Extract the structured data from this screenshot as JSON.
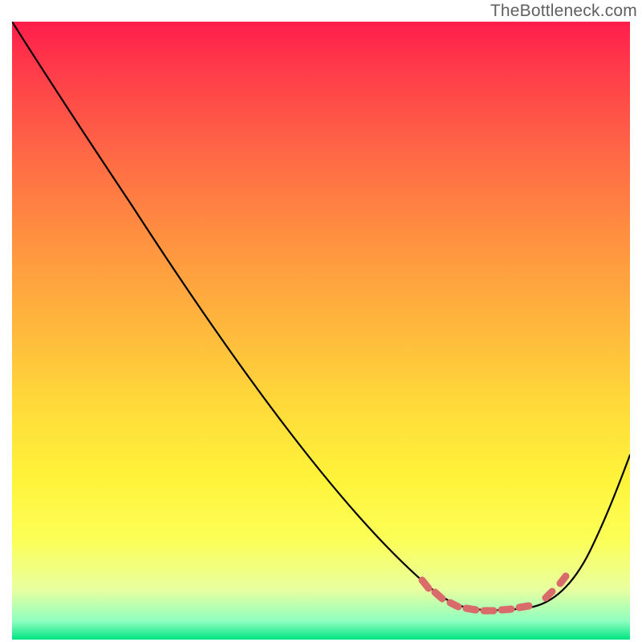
{
  "watermark": "TheBottleneck.com",
  "colors": {
    "gradient_top": "#ff1e4a",
    "gradient_mid": "#ffda3a",
    "gradient_bottom": "#00e582",
    "curve": "#000000",
    "ticks": "#d96b6b",
    "watermark_text": "#606060"
  },
  "chart_data": {
    "type": "line",
    "title": "",
    "xlabel": "",
    "ylabel": "",
    "xlim": [
      0,
      100
    ],
    "ylim": [
      0,
      100
    ],
    "series": [
      {
        "name": "curve",
        "x": [
          0,
          10,
          20,
          30,
          40,
          50,
          60,
          67,
          72,
          76,
          80,
          84,
          88,
          92,
          96,
          100
        ],
        "y": [
          100,
          85,
          70,
          56,
          42,
          30,
          18,
          9,
          6,
          5,
          4.5,
          5,
          7,
          12,
          20,
          30
        ]
      }
    ],
    "highlight_range_x": [
      66,
      90
    ],
    "annotations": [
      {
        "text": "TheBottleneck.com",
        "role": "watermark",
        "position": "top-right"
      }
    ],
    "grid": false,
    "legend": false,
    "background": "vertical-gradient red→yellow→green"
  }
}
